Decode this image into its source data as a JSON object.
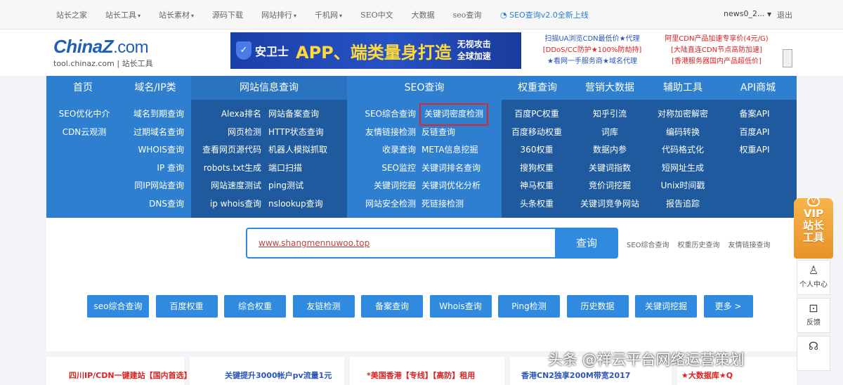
{
  "topbar": {
    "links": [
      {
        "label": "站长之家",
        "dropdown": false
      },
      {
        "label": "站长工具",
        "dropdown": true
      },
      {
        "label": "站长素材",
        "dropdown": true
      },
      {
        "label": "源码下载",
        "dropdown": false
      },
      {
        "label": "网站排行",
        "dropdown": true
      },
      {
        "label": "千机网",
        "dropdown": true
      },
      {
        "label": "SEO中文",
        "dropdown": false
      },
      {
        "label": "大数据",
        "dropdown": false
      },
      {
        "label": "seo查询",
        "dropdown": false
      }
    ],
    "notice": "SEO查询v2.0全新上线",
    "user": "news0_2...",
    "logout": "退出"
  },
  "header": {
    "logo_brand": "ChinaZ",
    "logo_dotcom": ".com",
    "logo_sub": "tool.chinaz.com | 站长工具",
    "banner": {
      "name": "安卫士",
      "main": "APP、端类量身打造",
      "side_line1": "无视攻击",
      "side_line2": "全球加速"
    },
    "ad_mid": [
      "扫描UA浏览CDN最低价★代理",
      "[DDoS/CC防护★100%防劫持]",
      "★看网一手服务商★域名代理"
    ],
    "ad_right": [
      "阿里CDN产品加速专享价(4元/G)",
      "[大陆直连CDN节点高防加速]",
      "[香港服务器国内产品超低价]"
    ]
  },
  "nav": {
    "categories": [
      "首页",
      "域名/IP类",
      "网站信息查询",
      "SEO查询",
      "权重查询",
      "营销大数据",
      "辅助工具",
      "API商城"
    ],
    "columns": [
      [
        "SEO优化中介",
        "CDN云观测"
      ],
      [
        "域名到期查询",
        "过期域名查询",
        "WHOIS查询",
        "IP 查询",
        "同IP网站查询",
        "DNS查询"
      ],
      [
        "Alexa排名",
        "网页检测",
        "查看网页源代码",
        "robots.txt生成",
        "网站速度测试",
        "ip whois查询"
      ],
      [
        "网站备案查询",
        "HTTP状态查询",
        "机器人模拟抓取",
        "端口扫描",
        "ping测试",
        "nslookup查询"
      ],
      [
        "SEO综合查询",
        "友情链接检测",
        "收录查询",
        "SEO监控",
        "关键词挖掘",
        "网站安全检测"
      ],
      [
        "关键词密度检测",
        "反链查询",
        "META信息挖掘",
        "关键词排名查询",
        "关键词优化分析",
        "死链接检测"
      ],
      [
        "百度PC权重",
        "百度移动权重",
        "360权重",
        "搜狗权重",
        "神马权重",
        "头条权重"
      ],
      [
        "知乎引流",
        "词库",
        "数据内参",
        "关键词指数",
        "竞价词挖掘",
        "关键词竞争网站"
      ],
      [
        "对称加密解密",
        "编码转换",
        "代码格式化",
        "短网址生成",
        "Unix时间戳",
        "报告追踪"
      ],
      [
        "备案API",
        "百度API",
        "权重API"
      ]
    ],
    "highlighted_item": "关键词密度检测"
  },
  "search": {
    "value": "www.shangmennuwoo.top",
    "button": "查询",
    "quick_links": [
      "SEO综合查询",
      "权重历史查询",
      "友情链接查询"
    ]
  },
  "tool_buttons": [
    "seo综合查询",
    "百度权重",
    "综合权重",
    "友链检测",
    "备案查询",
    "Whois查询",
    "Ping检测",
    "历史数据",
    "关键词挖掘",
    "更多 >"
  ],
  "footer_ads": [
    "四川IP/CDN一键建站【国内首选】",
    "关键提升3000帐户pv流量1元",
    "*美国香港【专线】【高防】租用",
    "香港CN2独享200M带宽2017",
    "★大数据库★Q"
  ],
  "sidebar": {
    "vip_badge": "V",
    "vip_text": "VIP站长工具",
    "vip_line1": "VIP",
    "vip_line2": "站长",
    "vip_line3": "工具",
    "user_center": "个人中心",
    "feedback": "反馈"
  },
  "watermark": "头条 @祥云平台网络运营策划",
  "colors": {
    "nav_blue": "#2f7fd0",
    "nav_dark": "#1e5a9d",
    "accent_blue": "#2f8ae0",
    "brand_blue": "#1e5fb8",
    "highlight_red": "#e0262b",
    "vip_orange": "#f0a03a"
  }
}
